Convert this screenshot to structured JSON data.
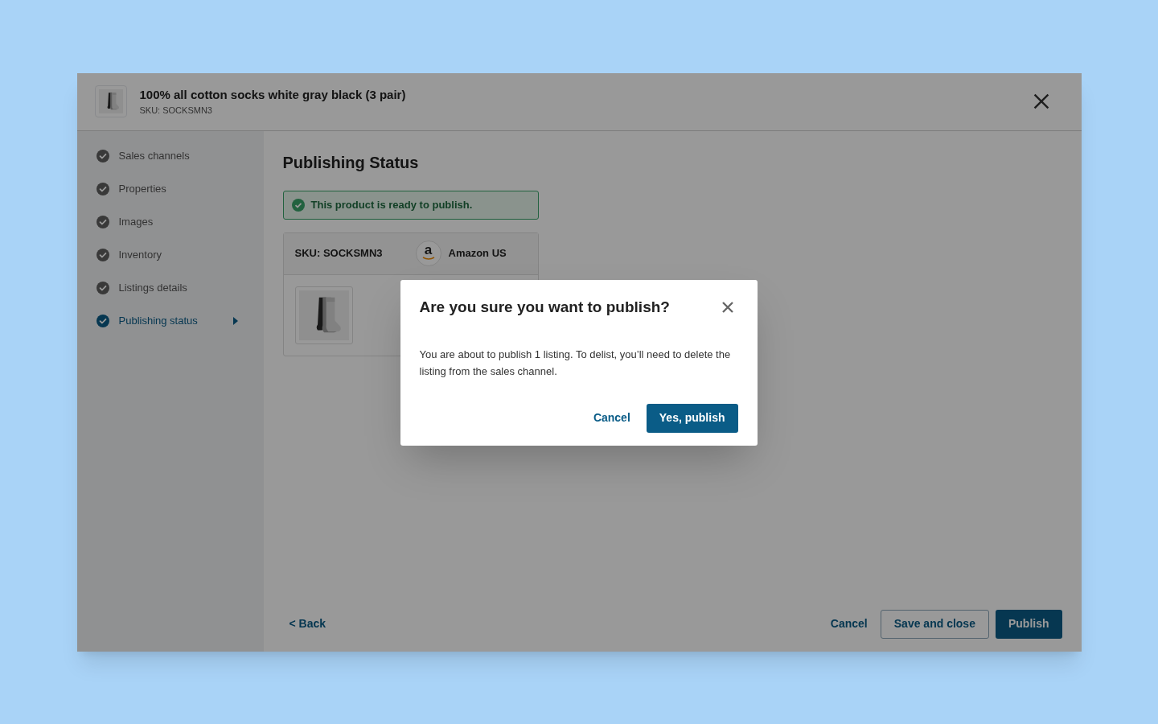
{
  "product": {
    "title": "100% all cotton socks white gray black (3 pair)",
    "sku": "SKU: SOCKSMN3"
  },
  "steps": [
    {
      "label": "Sales channels",
      "selected": false
    },
    {
      "label": "Properties",
      "selected": false
    },
    {
      "label": "Images",
      "selected": false
    },
    {
      "label": "Inventory",
      "selected": false
    },
    {
      "label": "Listings details",
      "selected": false
    },
    {
      "label": "Publishing status",
      "selected": true
    }
  ],
  "heading": "Publishing Status",
  "alert": "This product is ready to publish.",
  "listing": {
    "sku": "SKU: SOCKSMN3",
    "logo_letter": "a",
    "channel": "Amazon US"
  },
  "footer": {
    "back": "< Back",
    "cancel": "Cancel",
    "save": "Save and close",
    "publish": "Publish"
  },
  "dialog": {
    "title": "Are you sure you want to publish?",
    "body": "You are about to publish 1 listing. To delist, you’ll need to delete the listing from the sales channel.",
    "cancel": "Cancel",
    "confirm": "Yes, publish"
  }
}
